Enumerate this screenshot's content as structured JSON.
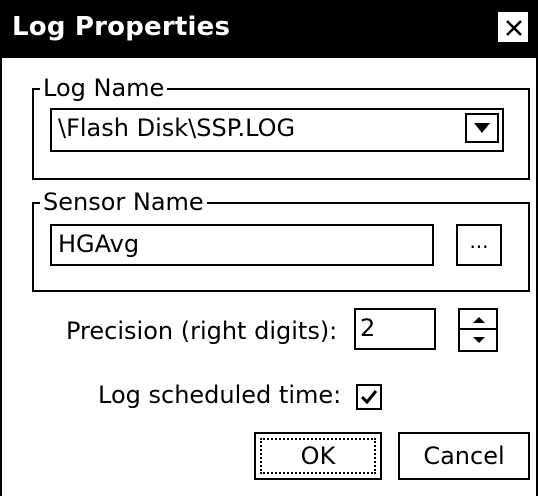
{
  "dialog": {
    "title": "Log Properties",
    "close_glyph": "✕"
  },
  "log_name": {
    "legend": "Log Name",
    "value": "\\Flash Disk\\SSP.LOG"
  },
  "sensor_name": {
    "legend": "Sensor Name",
    "value": "HGAvg",
    "browse_label": "..."
  },
  "precision": {
    "label": "Precision (right digits):",
    "value": "2"
  },
  "log_scheduled_time": {
    "label": "Log scheduled time:",
    "checked": true
  },
  "buttons": {
    "ok_label": "OK",
    "cancel_label": "Cancel"
  },
  "colors": {
    "titlebar_bg": "#000000",
    "titlebar_fg": "#ffffff",
    "background": "#ffffff",
    "border": "#000000"
  }
}
